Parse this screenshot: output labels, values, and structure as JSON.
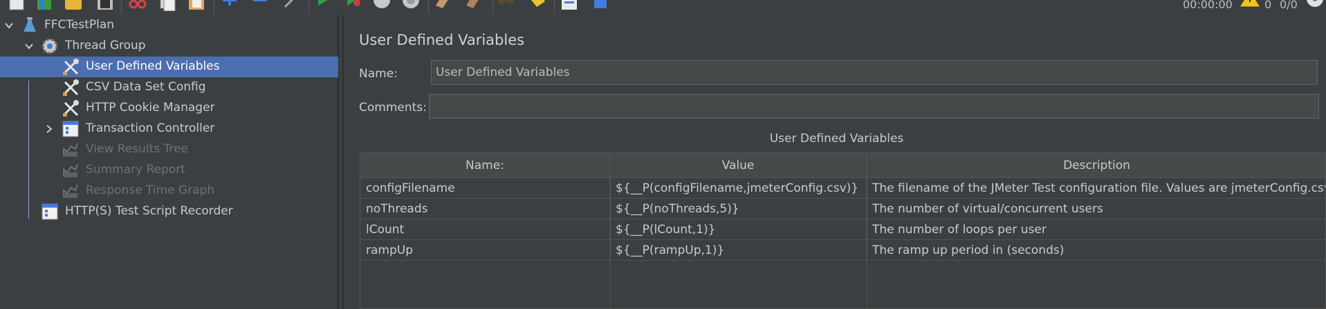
{
  "toolbar": {
    "buttons": [
      {
        "name": "new-icon",
        "color": "#e8e8e8"
      },
      {
        "name": "templates-icon",
        "color": "#3c9b3c"
      },
      {
        "name": "open-icon",
        "color": "#e8b53c"
      },
      {
        "name": "save-icon",
        "color": "#bdbdbd"
      },
      {
        "name": "cut-icon",
        "color": "#d64545"
      },
      {
        "name": "copy-icon",
        "color": "#d9d9d9"
      },
      {
        "name": "paste-icon",
        "color": "#e0a85c"
      },
      {
        "name": "expand-icon",
        "color": "#3d7fe0"
      },
      {
        "name": "collapse-icon",
        "color": "#3d7fe0"
      },
      {
        "name": "toggle-icon",
        "color": "#9aa8b8"
      },
      {
        "name": "start-icon",
        "color": "#2ea043"
      },
      {
        "name": "start-no-pauses-icon",
        "color": "#2ea043"
      },
      {
        "name": "stop-icon",
        "color": "#c8c8c8"
      },
      {
        "name": "shutdown-icon",
        "color": "#c8c8c8"
      },
      {
        "name": "clear-icon",
        "color": "#c49a6c"
      },
      {
        "name": "clear-all-icon",
        "color": "#c49a6c"
      },
      {
        "name": "search-icon",
        "color": "#9a8866"
      },
      {
        "name": "reset-search-icon",
        "color": "#e8c430"
      },
      {
        "name": "function-helper-icon",
        "color": "#3d7fe0"
      },
      {
        "name": "help-icon",
        "color": "#3d7fe0"
      }
    ],
    "status": {
      "timer": "00:00:00",
      "warnings": "0",
      "threads": "0/0",
      "warning_icon": "warning-icon",
      "threads_icon": "threads-icon"
    }
  },
  "tree": {
    "items": [
      {
        "label": "FFCTestPlan",
        "icon": "test-plan-icon",
        "expander": "chevron-down-icon",
        "state": "normal"
      },
      {
        "label": "Thread Group",
        "icon": "gear-icon",
        "expander": "chevron-down-icon",
        "state": "normal"
      },
      {
        "label": "User Defined Variables",
        "icon": "config-element-icon",
        "expander": "",
        "state": "selected"
      },
      {
        "label": "CSV Data Set Config",
        "icon": "config-element-icon",
        "expander": "",
        "state": "normal"
      },
      {
        "label": "HTTP Cookie Manager",
        "icon": "config-element-icon",
        "expander": "",
        "state": "normal"
      },
      {
        "label": "Transaction Controller",
        "icon": "controller-icon",
        "expander": "chevron-right-icon",
        "state": "normal"
      },
      {
        "label": "View Results Tree",
        "icon": "listener-icon",
        "expander": "",
        "state": "disabled"
      },
      {
        "label": "Summary Report",
        "icon": "listener-icon",
        "expander": "",
        "state": "disabled"
      },
      {
        "label": "Response Time Graph",
        "icon": "listener-icon",
        "expander": "",
        "state": "disabled"
      },
      {
        "label": "HTTP(S) Test Script Recorder",
        "icon": "recorder-icon",
        "expander": "",
        "state": "normal"
      }
    ]
  },
  "main": {
    "title": "User Defined Variables",
    "name_label": "Name:",
    "name_value": "User Defined Variables",
    "comments_label": "Comments:",
    "comments_value": "",
    "table_caption": "User Defined Variables",
    "columns": [
      "Name:",
      "Value",
      "Description"
    ],
    "rows": [
      [
        "configFilename",
        "${__P(configFilename,jmeterConfig.csv)}",
        "The filename of the JMeter Test configuration file. Values are jmeterConfig.csv, j..."
      ],
      [
        "noThreads",
        "${__P(noThreads,5)}",
        "The number of virtual/concurrent users"
      ],
      [
        "lCount",
        "${__P(lCount,1)}",
        "The number of loops per user"
      ],
      [
        "rampUp",
        "${__P(rampUp,1)}",
        "The ramp up period in (seconds)"
      ]
    ]
  }
}
